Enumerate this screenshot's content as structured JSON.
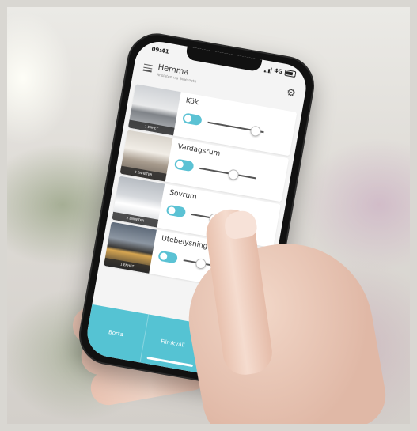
{
  "status_bar": {
    "time": "09:41",
    "carrier": "4G"
  },
  "header": {
    "title": "Hemma",
    "subtitle": "Ansluten via Bluetooth"
  },
  "rooms": [
    {
      "name": "Kök",
      "units": "1 ENHET",
      "on": true,
      "level": 0.85,
      "photo": "kitchen"
    },
    {
      "name": "Vardagsrum",
      "units": "3 ENHETER",
      "on": true,
      "level": 0.6,
      "photo": "living"
    },
    {
      "name": "Sovrum",
      "units": "2 ENHETER",
      "on": true,
      "level": 0.4,
      "photo": "bedroom"
    },
    {
      "name": "Utebelysning",
      "units": "1 ENHET",
      "on": true,
      "level": 0.3,
      "photo": "exterior"
    }
  ],
  "bottom_bar": {
    "away_label": "Borta",
    "movie_label": "Filmkväll"
  },
  "colors": {
    "accent": "#55c3d3"
  }
}
